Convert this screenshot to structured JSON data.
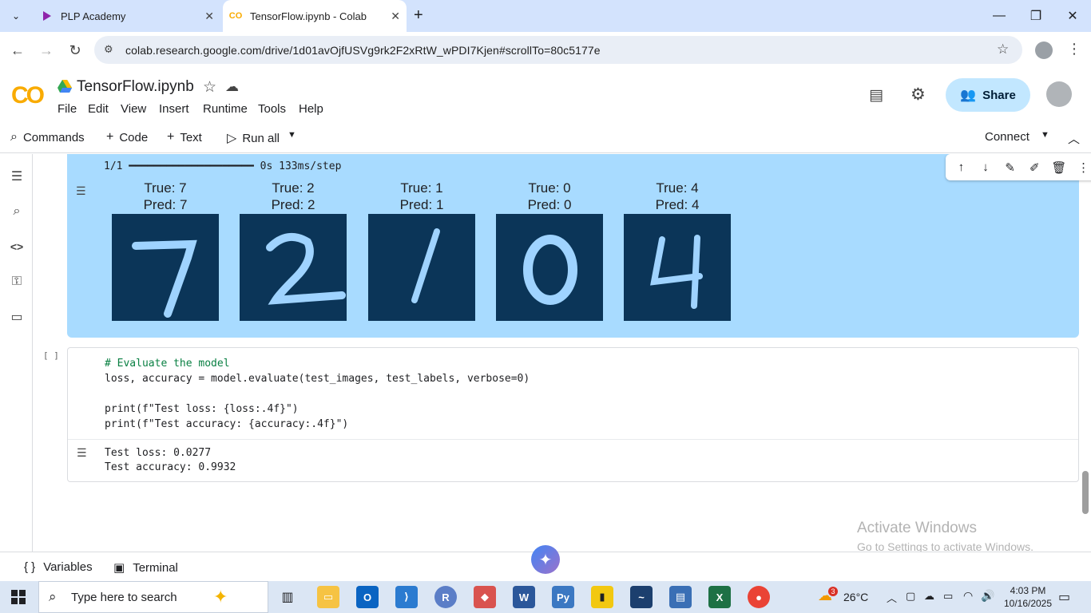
{
  "browser": {
    "tabs": [
      {
        "title": "PLP Academy",
        "active": false
      },
      {
        "title": "TensorFlow.ipynb - Colab",
        "active": true
      }
    ],
    "url": "colab.research.google.com/drive/1d01avOjfUSVg9rk2F2xRtW_wPDI7Kjen#scrollTo=80c5177e"
  },
  "colab": {
    "logo_text": "CO",
    "notebook_title": "TensorFlow.ipynb",
    "menu": [
      "File",
      "Edit",
      "View",
      "Insert",
      "Runtime",
      "Tools",
      "Help"
    ],
    "share_label": "Share",
    "commands_label": "Commands",
    "add_code_label": "Code",
    "add_text_label": "Text",
    "run_all_label": "Run all",
    "connect_label": "Connect"
  },
  "cells": {
    "prediction_output": {
      "progress_line": "1/1 ━━━━━━━━━━━━━━━━━━━━ 0s 133ms/step",
      "digits": [
        {
          "true_label": "True: 7",
          "pred_label": "Pred: 7",
          "glyph": "7"
        },
        {
          "true_label": "True: 2",
          "pred_label": "Pred: 2",
          "glyph": "2"
        },
        {
          "true_label": "True: 1",
          "pred_label": "Pred: 1",
          "glyph": "1"
        },
        {
          "true_label": "True: 0",
          "pred_label": "Pred: 0",
          "glyph": "0"
        },
        {
          "true_label": "True: 4",
          "pred_label": "Pred: 4",
          "glyph": "4"
        }
      ]
    },
    "evaluate_cell": {
      "run_indicator": "[ ]",
      "code_lines": [
        "# Evaluate the model",
        "loss, accuracy = model.evaluate(test_images, test_labels, verbose=0)",
        "",
        "print(f\"Test loss: {loss:.4f}\")",
        "print(f\"Test accuracy: {accuracy:.4f}\")"
      ],
      "output_lines": [
        "Test loss: 0.0277",
        "Test accuracy: 0.9932"
      ]
    }
  },
  "watermark": {
    "line1": "Activate Windows",
    "line2": "Go to Settings to activate Windows."
  },
  "bottom_bar": {
    "variables_label": "Variables",
    "terminal_label": "Terminal"
  },
  "taskbar": {
    "search_placeholder": "Type here to search",
    "weather": "26°C",
    "weather_badge": "3",
    "time": "4:03 PM",
    "date": "10/16/2025"
  },
  "colors": {
    "accent": "#1a73e8",
    "output_bg": "#a8dbff",
    "digit_bg": "#0b3558",
    "digit_fg": "#9fd3ff"
  }
}
